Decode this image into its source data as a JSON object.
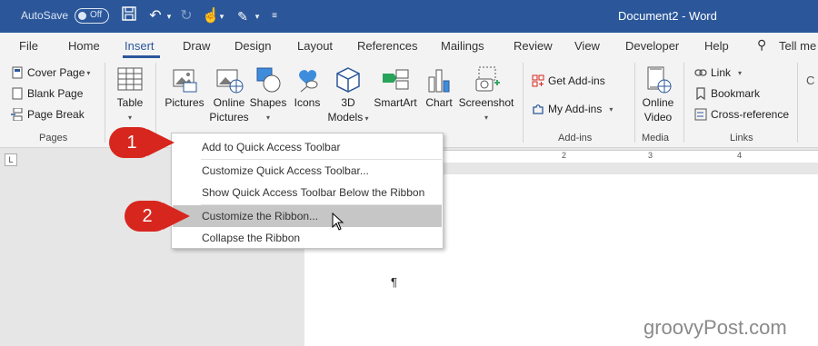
{
  "titlebar": {
    "autosave_label": "AutoSave",
    "toggle_state": "Off",
    "document_title": "Document2  -  Word",
    "accent_color": "#2b579a"
  },
  "tabs": [
    {
      "label": "File"
    },
    {
      "label": "Home"
    },
    {
      "label": "Insert",
      "active": true
    },
    {
      "label": "Draw"
    },
    {
      "label": "Design"
    },
    {
      "label": "Layout"
    },
    {
      "label": "References"
    },
    {
      "label": "Mailings"
    },
    {
      "label": "Review"
    },
    {
      "label": "View"
    },
    {
      "label": "Developer"
    },
    {
      "label": "Help"
    },
    {
      "label": "Tell me"
    }
  ],
  "ribbon": {
    "pages": {
      "cover_page": "Cover Page",
      "blank_page": "Blank Page",
      "page_break": "Page Break",
      "group_label": "Pages"
    },
    "table": {
      "label": "Table"
    },
    "illustrations": {
      "pictures": "Pictures",
      "online_pictures_1": "Online",
      "online_pictures_2": "Pictures",
      "shapes": "Shapes",
      "icons": "Icons",
      "models_1": "3D",
      "models_2": "Models",
      "smartart": "SmartArt",
      "chart": "Chart",
      "screenshot": "Screenshot"
    },
    "addins": {
      "get_addins": "Get Add-ins",
      "my_addins": "My Add-ins",
      "group_label": "Add-ins"
    },
    "media": {
      "online_video_1": "Online",
      "online_video_2": "Video",
      "group_label": "Media"
    },
    "links": {
      "link": "Link",
      "bookmark": "Bookmark",
      "cross_reference": "Cross-reference",
      "group_label": "Links"
    }
  },
  "context_menu": {
    "items": [
      "Add to Quick Access Toolbar",
      "Customize Quick Access Toolbar...",
      "Show Quick Access Toolbar Below the Ribbon",
      "Customize the Ribbon...",
      "Collapse the Ribbon"
    ]
  },
  "callouts": {
    "one": "1",
    "two": "2",
    "color": "#d7261e"
  },
  "document": {
    "paragraph_mark": "¶"
  },
  "ruler": {
    "numbers": [
      "1",
      "2",
      "3",
      "4"
    ]
  },
  "watermark": "groovyPost.com"
}
